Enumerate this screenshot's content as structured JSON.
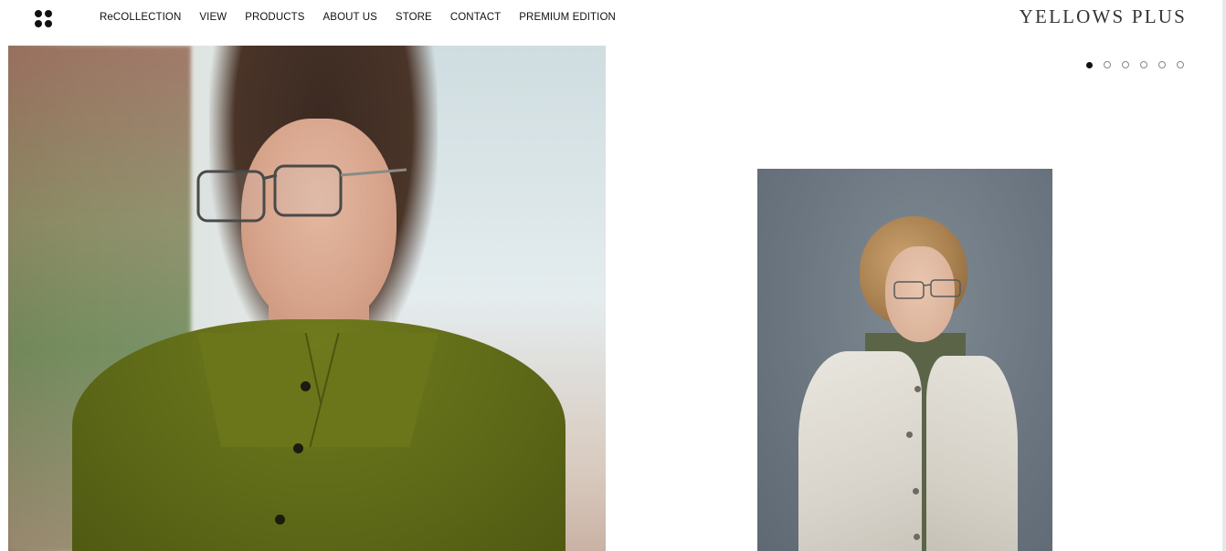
{
  "header": {
    "logo": "YELLOWS PLUS",
    "menu_icon": "grid-dots-icon",
    "nav": [
      {
        "label": "ReCOLLECTION"
      },
      {
        "label": "VIEW"
      },
      {
        "label": "PRODUCTS"
      },
      {
        "label": "ABOUT US"
      },
      {
        "label": "STORE"
      },
      {
        "label": "CONTACT"
      },
      {
        "label": "PREMIUM EDITION"
      }
    ]
  },
  "slider": {
    "total_slides": 6,
    "active_index": 1
  },
  "colors": {
    "text": "#111111",
    "logo": "#333333",
    "background": "#ffffff"
  }
}
